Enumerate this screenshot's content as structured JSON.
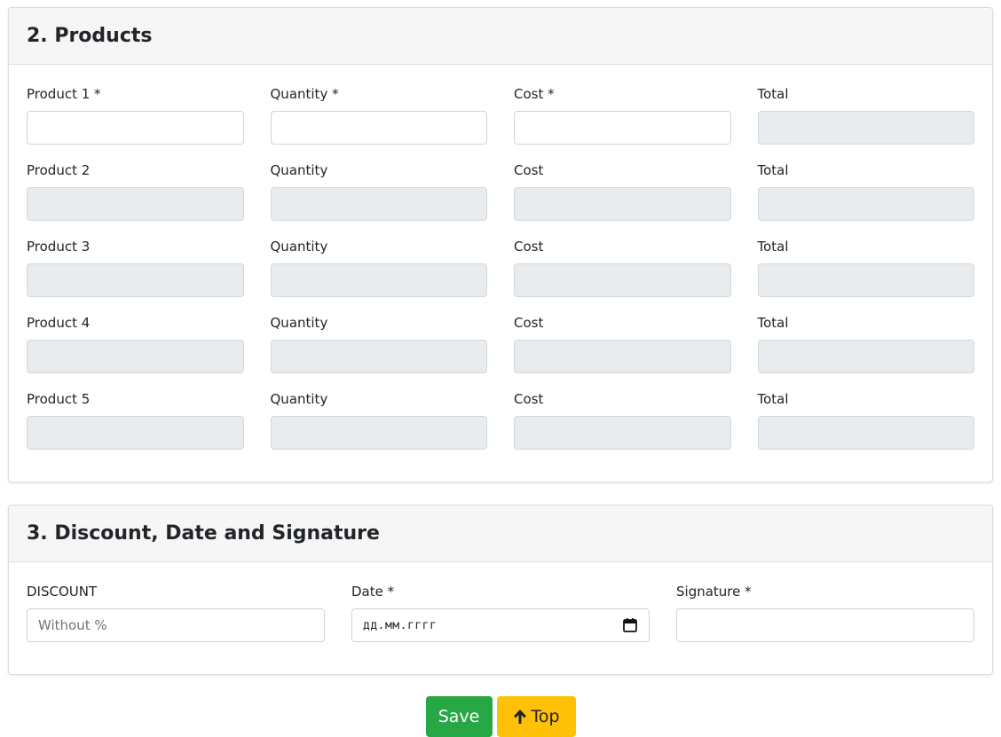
{
  "products_section": {
    "title": "2. Products",
    "rows": [
      {
        "product_label": "Product 1 *",
        "quantity_label": "Quantity *",
        "cost_label": "Cost *",
        "total_label": "Total"
      },
      {
        "product_label": "Product 2",
        "quantity_label": "Quantity",
        "cost_label": "Cost",
        "total_label": "Total"
      },
      {
        "product_label": "Product 3",
        "quantity_label": "Quantity",
        "cost_label": "Cost",
        "total_label": "Total"
      },
      {
        "product_label": "Product 4",
        "quantity_label": "Quantity",
        "cost_label": "Cost",
        "total_label": "Total"
      },
      {
        "product_label": "Product 5",
        "quantity_label": "Quantity",
        "cost_label": "Cost",
        "total_label": "Total"
      }
    ]
  },
  "final_section": {
    "title": "3. Discount, Date and Signature",
    "discount_label": "DISCOUNT",
    "discount_placeholder": "Without %",
    "date_label": "Date *",
    "date_placeholder": "дд.мм.гггг",
    "signature_label": "Signature *"
  },
  "actions": {
    "save_label": "Save",
    "top_label": "Top"
  },
  "icons": {
    "calendar": "calendar-icon",
    "arrow_up": "arrow-up-icon"
  },
  "colors": {
    "save_button": "#28a745",
    "top_button": "#ffc107",
    "disabled_field": "#e9ecef",
    "card_header": "#f6f6f6"
  }
}
